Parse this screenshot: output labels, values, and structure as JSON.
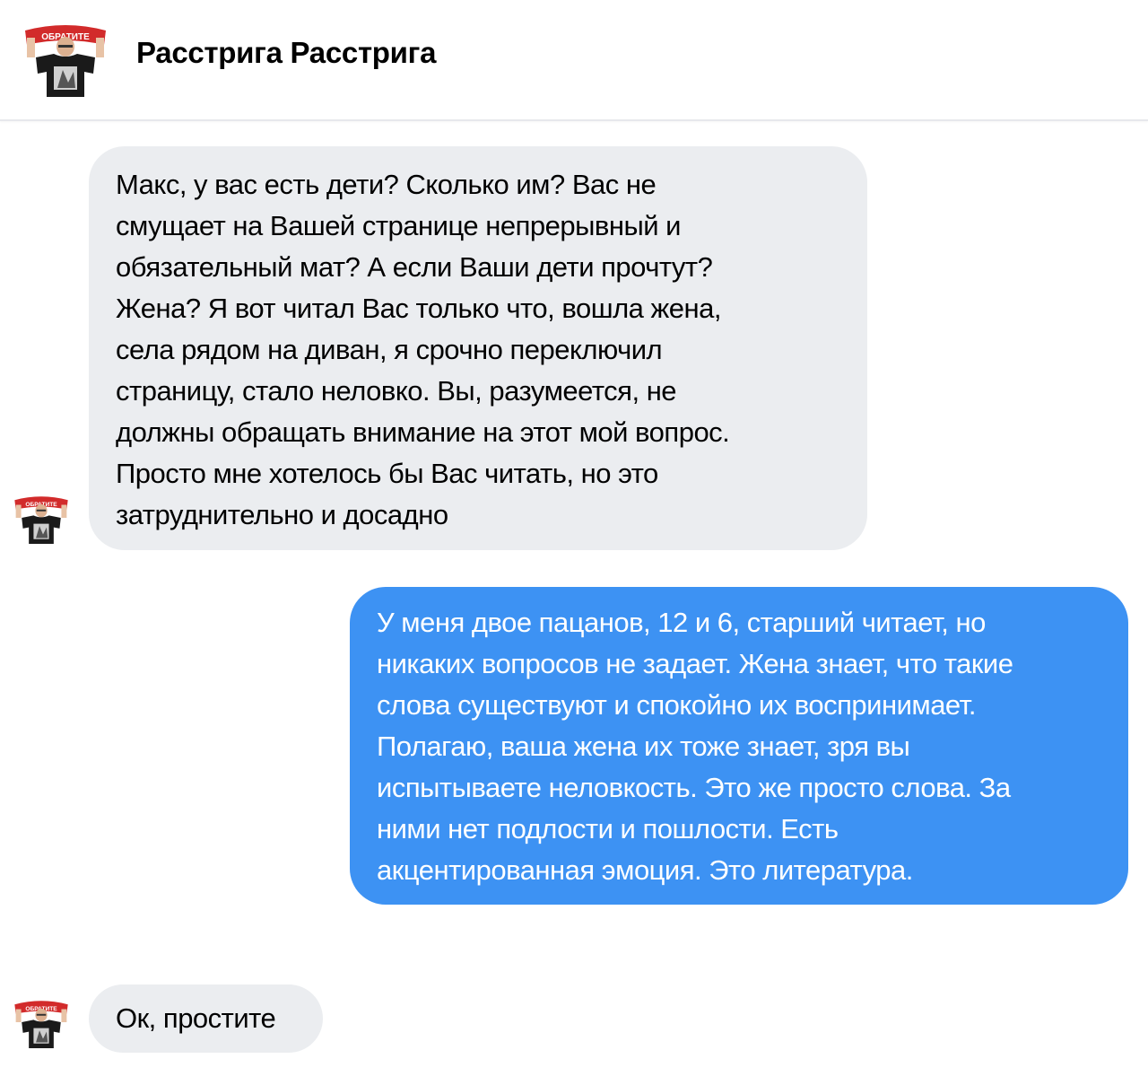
{
  "chat": {
    "contact_name": "Расстрига Расстрига",
    "avatar_icon": "avatar-man-red-banner-icon",
    "avatar_banner_text": "ОБРАТИТЕ"
  },
  "messages": [
    {
      "direction": "incoming",
      "text": "Макс, у вас есть дети? Сколько им? Вас не\nсмущает на Вашей странице непрерывный и\nобязательный мат?  А если Ваши дети прочтут?\nЖена? Я вот читал Вас только что, вошла жена,\nсела рядом на диван, я срочно переключил\nстраницу, стало неловко. Вы, разумеется, не\nдолжны обращать внимание на этот мой вопрос.\nПросто мне хотелось бы Вас читать, но это\nзатруднительно и досадно"
    },
    {
      "direction": "outgoing",
      "text": "У меня двое пацанов, 12 и 6, старший читает, но\nникаких вопросов не задает. Жена знает, что такие\nслова существуют и спокойно их воспринимает.\nПолагаю, ваша жена их тоже знает, зря вы\nиспытываете неловкость. Это же просто слова. За\nними нет подлости и пошлости. Есть\nакцентированная эмоция. Это литература."
    },
    {
      "direction": "incoming",
      "text": "Ок, простите"
    }
  ],
  "colors": {
    "incoming_bubble": "#ebedf0",
    "outgoing_bubble": "#3d92f3",
    "outgoing_text": "#ffffff",
    "header_border": "#e7e8ec"
  }
}
